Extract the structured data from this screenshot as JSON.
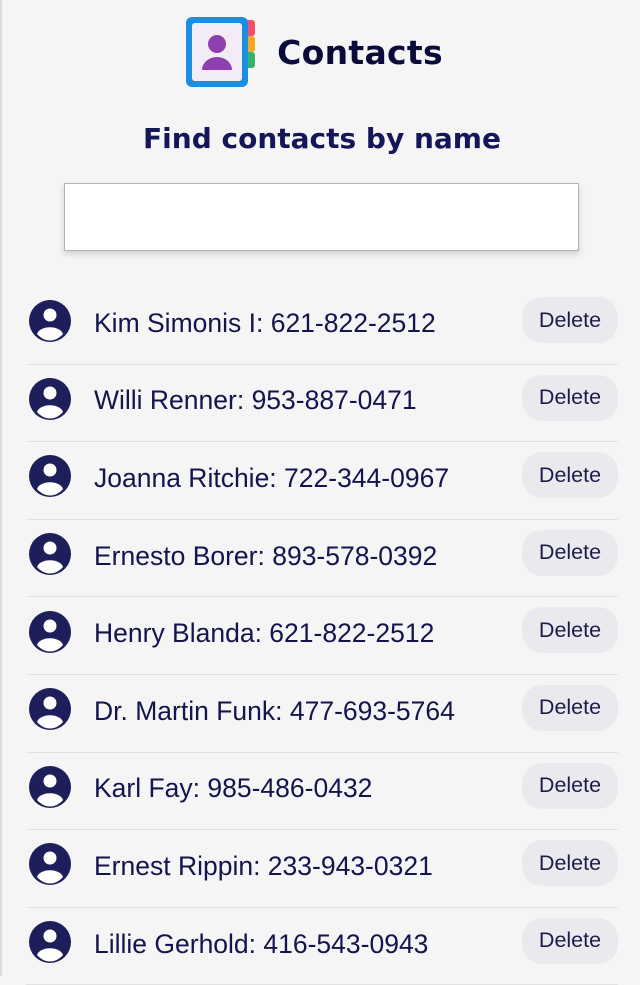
{
  "header": {
    "title": "Contacts",
    "logo_icon": "contacts-book-icon"
  },
  "search": {
    "heading": "Find contacts by name",
    "value": "",
    "placeholder": ""
  },
  "contacts": [
    {
      "text": "Kim Simonis I: 621-822-2512",
      "delete_label": "Delete"
    },
    {
      "text": "Willi Renner: 953-887-0471",
      "delete_label": "Delete"
    },
    {
      "text": "Joanna Ritchie: 722-344-0967",
      "delete_label": "Delete"
    },
    {
      "text": "Ernesto Borer: 893-578-0392",
      "delete_label": "Delete"
    },
    {
      "text": "Henry Blanda: 621-822-2512",
      "delete_label": "Delete"
    },
    {
      "text": "Dr. Martin Funk: 477-693-5764",
      "delete_label": "Delete"
    },
    {
      "text": "Karl Fay: 985-486-0432",
      "delete_label": "Delete"
    },
    {
      "text": "Ernest Rippin: 233-943-0321",
      "delete_label": "Delete"
    },
    {
      "text": "Lillie Gerhold: 416-543-0943",
      "delete_label": "Delete"
    }
  ],
  "colors": {
    "accent_text": "#15155a",
    "avatar": "#1e1e5a",
    "delete_bg": "#eaeaee",
    "page_bg": "#f5f5f5"
  }
}
